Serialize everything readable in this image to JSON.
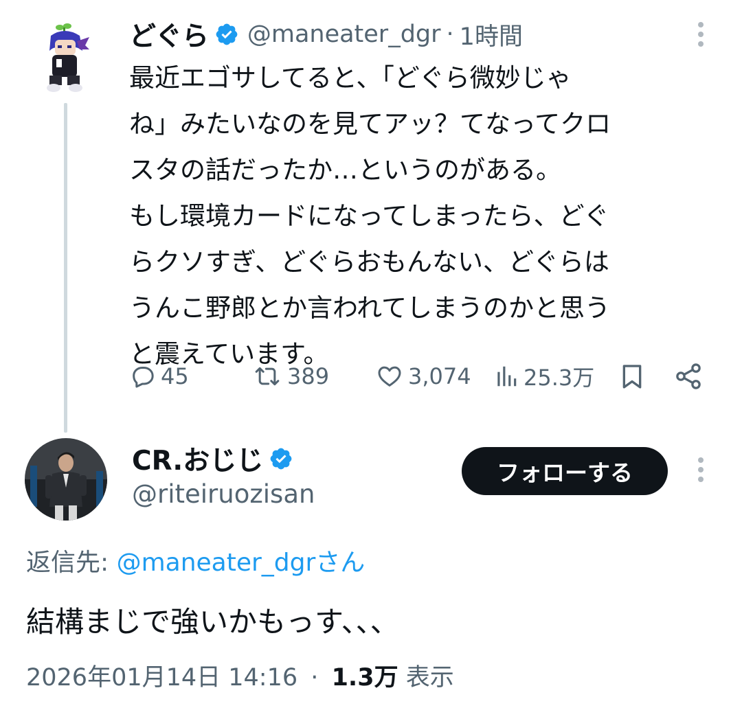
{
  "parent_tweet": {
    "display_name": "どぐら",
    "handle": "@maneater_dgr",
    "separator": "·",
    "time": "1時間",
    "text": "最近エゴサしてると、「どぐら微妙じゃ\nね」みたいなのを見てアッ？てなってクロ\nスタの話だったか…というのがある。\nもし環境カードになってしまったら、どぐ\nらクソすぎ、どぐらおもんない、どぐらは\nうんこ野郎とか言われてしまうのかと思う\nと震えています。",
    "stats": {
      "replies": "45",
      "retweets": "389",
      "likes": "3,074",
      "views": "25.3万"
    }
  },
  "reply_tweet": {
    "display_name": "CR.おじじ",
    "handle": "@riteiruozisan",
    "follow_label": "フォローする",
    "reply_to_prefix": "返信先: ",
    "reply_to_mention": "@maneater_dgrさん",
    "text": "結構まじで強いかもっす、、、",
    "date": "2026年01月14日 14:16",
    "separator": "·",
    "view_count": "1.3万",
    "view_label": "表示"
  },
  "icons": {
    "verified": "verified-badge-icon",
    "more": "more-vertical-icon",
    "reply": "reply-bubble-icon",
    "retweet": "retweet-icon",
    "like": "heart-icon",
    "views": "bar-chart-icon",
    "bookmark": "bookmark-icon",
    "share": "share-icon"
  },
  "colors": {
    "text_primary": "#0f1419",
    "text_secondary": "#536471",
    "accent_blue": "#1d9bf0",
    "thread_line": "#cfd9de",
    "follow_button_bg": "#0f1419"
  }
}
